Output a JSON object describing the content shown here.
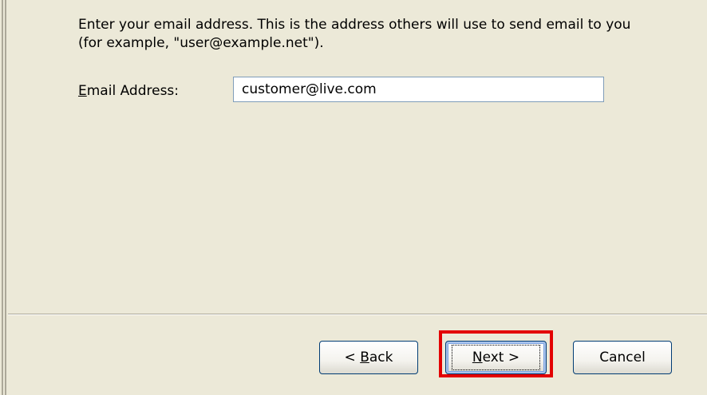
{
  "wizard": {
    "instructions": "Enter your email address. This is the address others will use to send email to you (for example, \"user@example.net\").",
    "email_label_accel": "E",
    "email_label_rest": "mail Address:",
    "email_value": "customer@live.com"
  },
  "buttons": {
    "back_prefix": "< ",
    "back_accel": "B",
    "back_rest": "ack",
    "next_accel": "N",
    "next_rest": "ext >",
    "cancel_label": "Cancel"
  },
  "colors": {
    "dialog_background": "#ece9d8",
    "highlight": "#e30000",
    "input_border": "#7f9db9"
  }
}
